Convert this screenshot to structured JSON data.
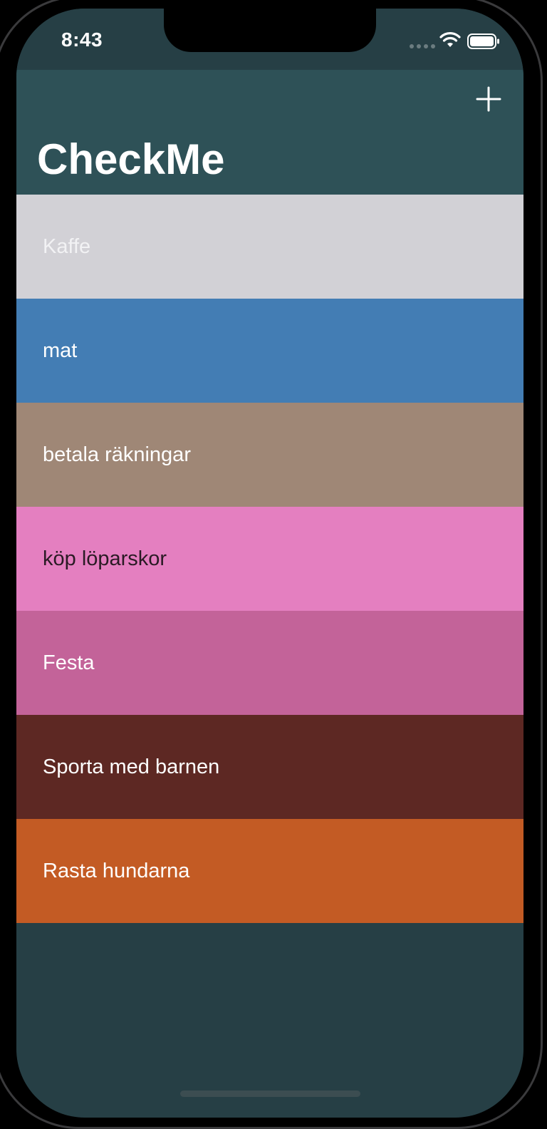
{
  "status_bar": {
    "time": "8:43"
  },
  "nav": {
    "title": "CheckMe",
    "add_icon": "plus-icon"
  },
  "colors": {
    "status_bar_bg": "#263f45",
    "nav_bg": "#2e5157",
    "screen_bg": "#263f45"
  },
  "items": [
    {
      "label": "Kaffe",
      "bg": "#d2d1d6",
      "fg": "#f2f2f4"
    },
    {
      "label": "mat",
      "bg": "#437db4",
      "fg": "#ffffff"
    },
    {
      "label": "betala räkningar",
      "bg": "#9f8776",
      "fg": "#ffffff"
    },
    {
      "label": "köp löparskor",
      "bg": "#e47fc0",
      "fg": "#2a1a24"
    },
    {
      "label": "Festa",
      "bg": "#c36399",
      "fg": "#ffffff"
    },
    {
      "label": "Sporta med barnen",
      "bg": "#5d2823",
      "fg": "#ffffff"
    },
    {
      "label": "Rasta hundarna",
      "bg": "#c35b24",
      "fg": "#ffffff"
    }
  ]
}
